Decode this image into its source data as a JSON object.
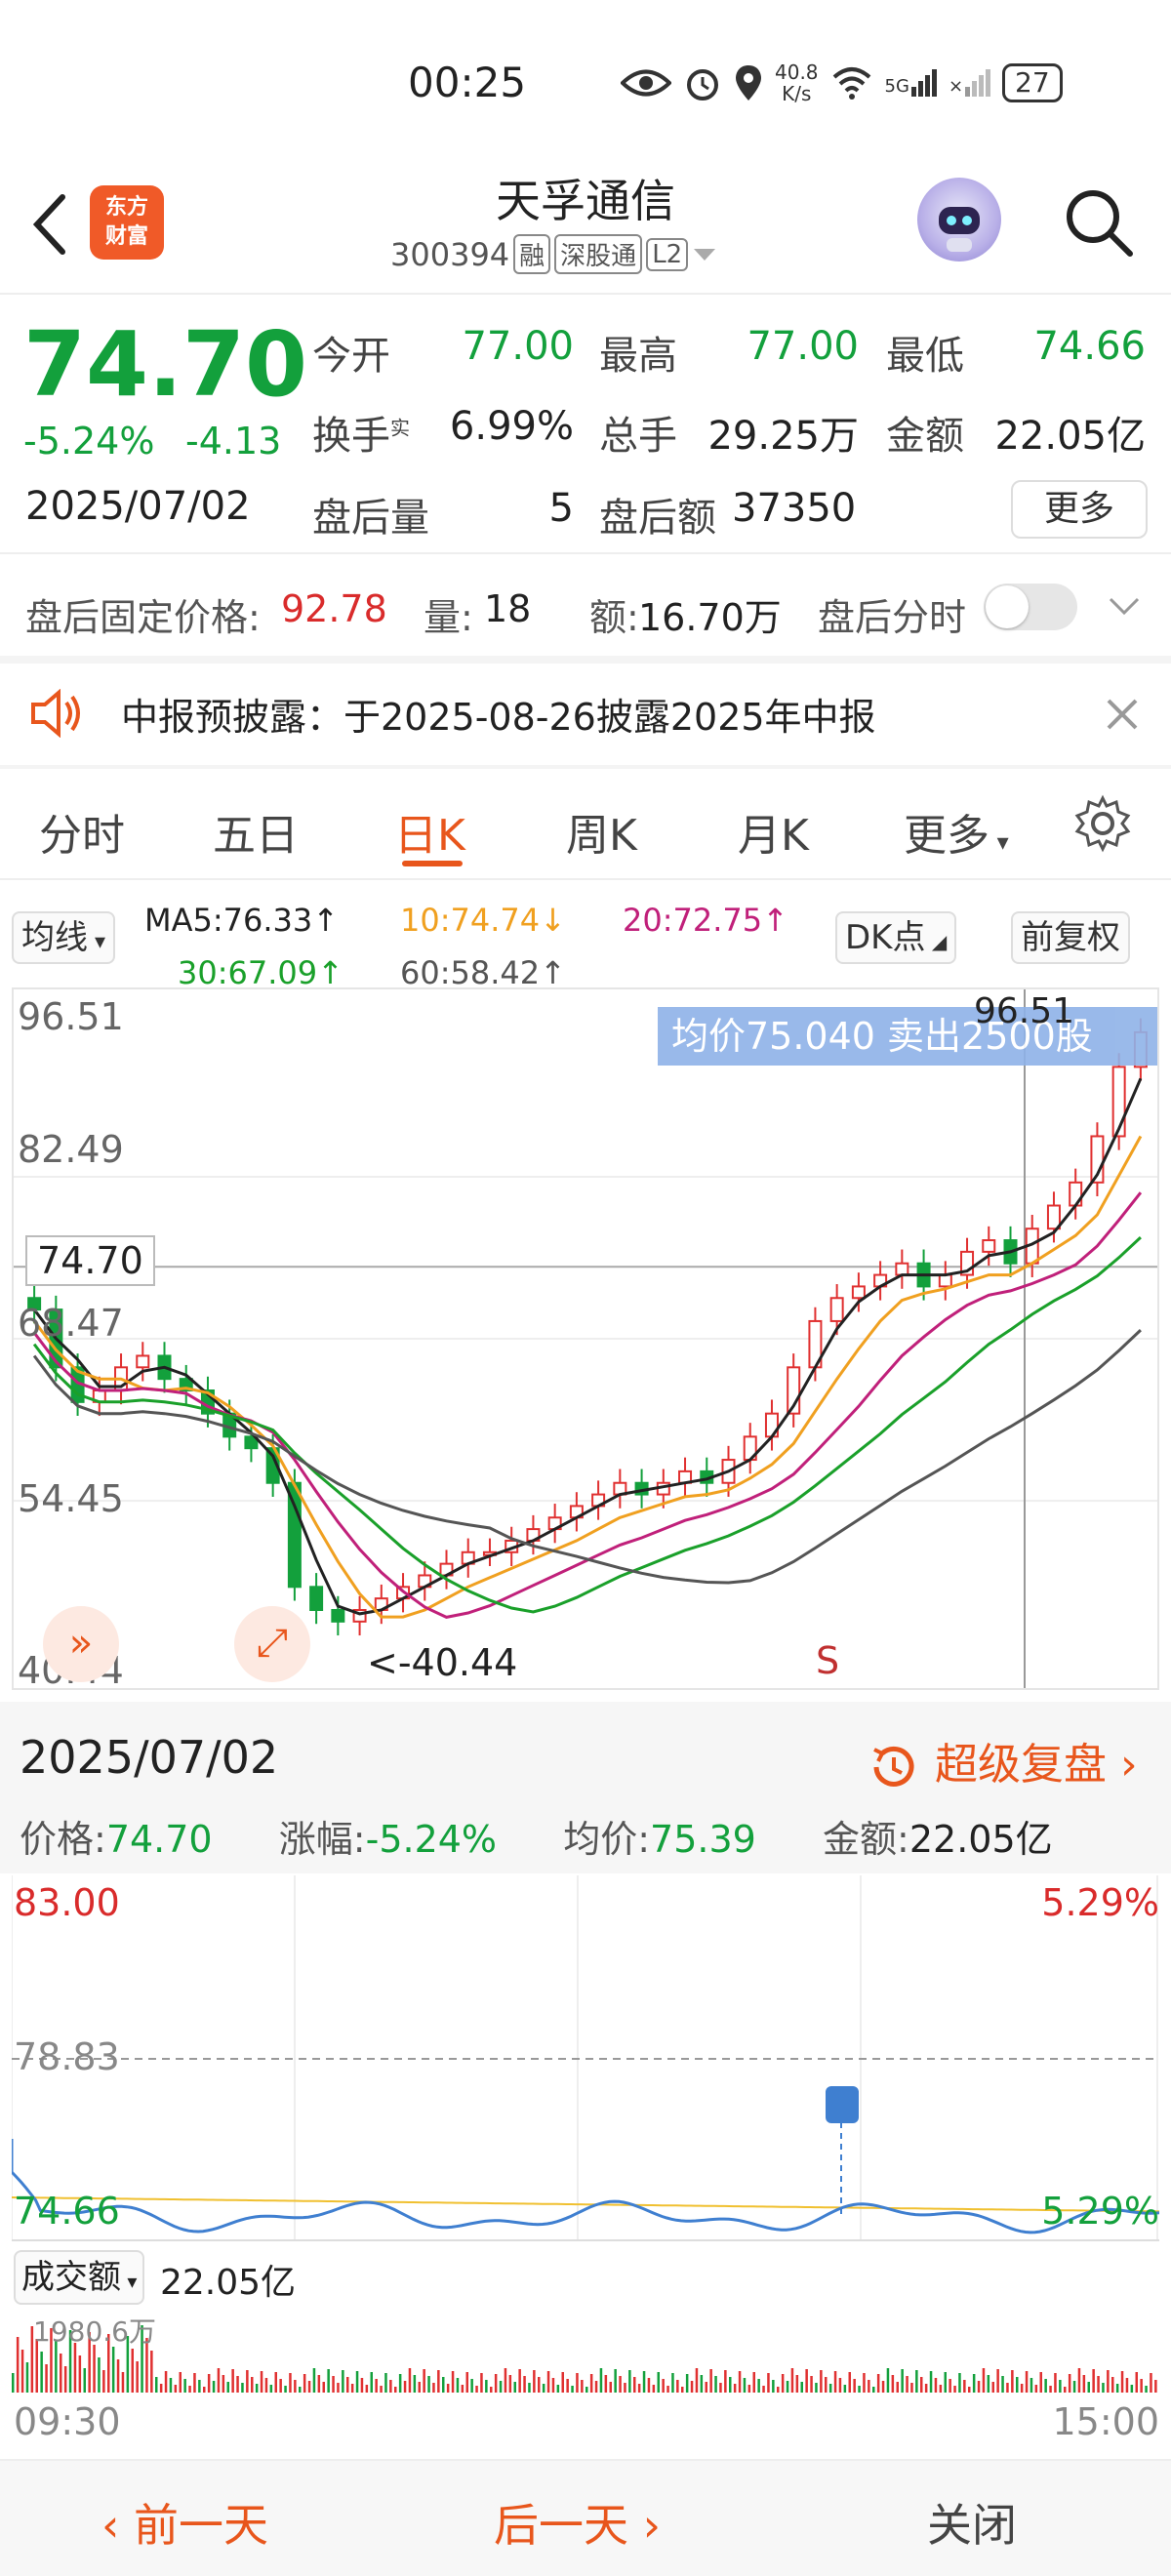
{
  "status_bar": {
    "time": "00:25",
    "net_speed_top": "40.8",
    "net_speed_bottom": "K/s",
    "signal": "5G",
    "battery": "27"
  },
  "header": {
    "stock_name": "天孚通信",
    "stock_code": "300394",
    "tags": [
      "融",
      "深股通",
      "L2"
    ],
    "logo_line1": "东方",
    "logo_line2": "财富"
  },
  "quote": {
    "price": "74.70",
    "change_pct": "-5.24%",
    "change_amt": "-4.13",
    "date": "2025/07/02",
    "open_label": "今开",
    "open": "77.00",
    "high_label": "最高",
    "high": "77.00",
    "low_label": "最低",
    "low": "74.66",
    "turnover_label": "换手",
    "turnover_sup": "实",
    "turnover": "6.99%",
    "volume_label": "总手",
    "volume": "29.25万",
    "amount_label": "金额",
    "amount": "22.05亿",
    "ah_volume_label": "盘后量",
    "ah_volume": "5",
    "ah_amount_label": "盘后额",
    "ah_amount": "37350",
    "more_label": "更多"
  },
  "after_hours": {
    "fixed_price_label": "盘后固定价格:",
    "fixed_price": "92.78",
    "qty_label": "量:",
    "qty": "18",
    "amt_label": "额:",
    "amt": "16.70万",
    "toggle_label": "盘后分时"
  },
  "notice": {
    "text": "中报预披露：于2025-08-26披露2025年中报"
  },
  "tabs": [
    {
      "label": "分时"
    },
    {
      "label": "五日"
    },
    {
      "label": "日K"
    },
    {
      "label": "周K"
    },
    {
      "label": "月K"
    },
    {
      "label": "更多"
    }
  ],
  "ma": {
    "selector": "均线",
    "ma5": "MA5:76.33↑",
    "ma10": "10:74.74↓",
    "ma20": "20:72.75↑",
    "ma30": "30:67.09↑",
    "ma60": "60:58.42↑",
    "dk": "DK点",
    "fq": "前复权"
  },
  "kline": {
    "y_labels": [
      "96.51",
      "82.49",
      "68.47",
      "54.45",
      "40.44"
    ],
    "current_price": "74.70",
    "banner": "均价75.040  卖出2500股",
    "max_marker": "96.51",
    "min_marker": "<-40.44",
    "s_marker": "S",
    "colors": {
      "up": "#e03030",
      "down": "#13a03c",
      "ma5": "#222222",
      "ma10": "#f0a020",
      "ma20": "#c0207a",
      "ma30": "#1aa02a",
      "ma60": "#555555"
    }
  },
  "detail": {
    "date": "2025/07/02",
    "replay": "超级复盘",
    "price_label": "价格:",
    "price": "74.70",
    "chg_label": "涨幅:",
    "chg": "-5.24%",
    "avg_label": "均价:",
    "avg": "75.39",
    "amt_label": "金额:",
    "amt": "22.05亿"
  },
  "minute": {
    "top_price": "83.00",
    "mid_price": "78.83",
    "bottom_price": "74.66",
    "top_pct": "5.29%",
    "bottom_pct": "5.29%",
    "vol_selector": "成交额",
    "vol_value": "22.05亿",
    "vol_scale": "1980.6万",
    "time_start": "09:30",
    "time_end": "15:00"
  },
  "bottom_bar": {
    "prev": "前一天",
    "next": "后一天",
    "close": "关闭"
  }
}
